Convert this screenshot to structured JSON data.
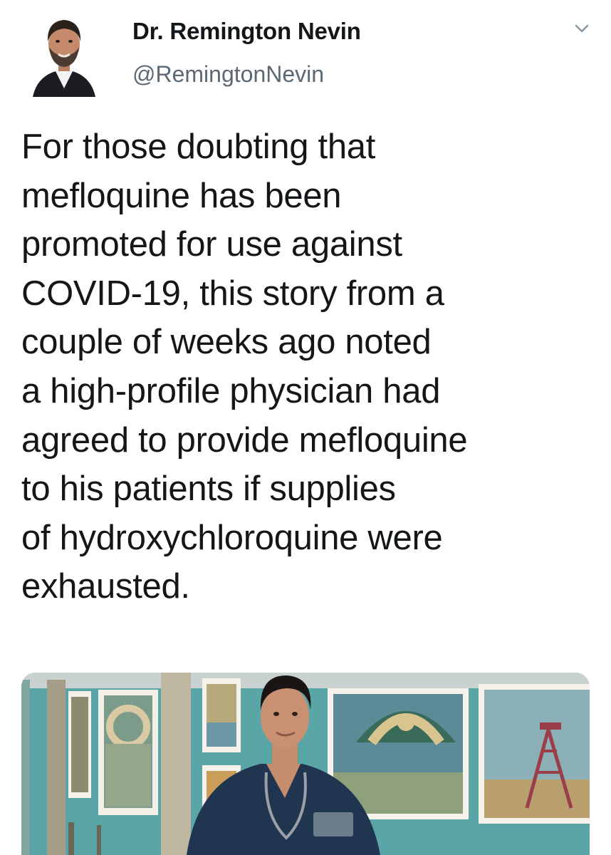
{
  "author": {
    "display_name": "Dr. Remington Nevin",
    "handle": "@RemingtonNevin"
  },
  "tweet": {
    "text_lines": [
      "For those doubting that",
      "mefloquine has been",
      "promoted for use against",
      "COVID-19, this story from a",
      "couple of weeks ago noted",
      "a high-profile physician had",
      "agreed to provide mefloquine",
      "to his patients if supplies",
      "of hydroxychloroquine were",
      "exhausted."
    ]
  },
  "icons": {
    "caret": "chevron-down-icon",
    "avatar": "profile-photo"
  },
  "colors": {
    "text": "#14171a",
    "secondary": "#5b6975",
    "wall": "#5aa6a6"
  }
}
